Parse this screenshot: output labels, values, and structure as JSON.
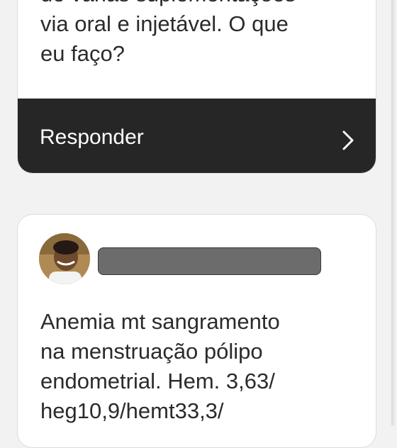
{
  "question_card": {
    "lines": [
      "de várias suplementações",
      "via oral e injetável. O que",
      "eu faço?"
    ],
    "reply_label": "Responder"
  },
  "post_card": {
    "author_name": "",
    "lines": [
      "Anemia mt sangramento",
      "na menstruação pólipo",
      "endometrial. Hem. 3,63/",
      "heg10,9/hemt33,3/"
    ]
  },
  "icons": {
    "reply_chevron": "chevron-right-icon",
    "avatar": "user-avatar"
  },
  "colors": {
    "reply_bar": "#262626",
    "card": "#ffffff",
    "background": "#f2f2f2",
    "text": "#2b2b2b"
  }
}
